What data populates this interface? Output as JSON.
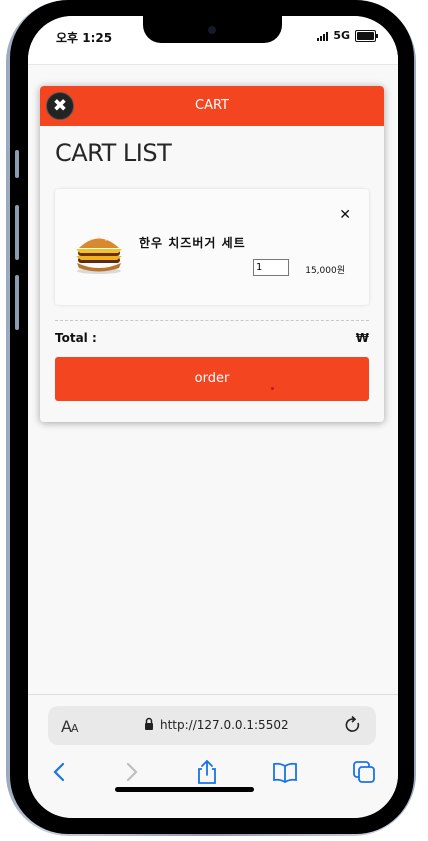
{
  "status_bar": {
    "time": "오후 1:25",
    "network": "5G"
  },
  "modal": {
    "header_title": "CART",
    "close_icon": "x-circle-icon",
    "cart_title": "CART LIST",
    "items": [
      {
        "name": "한우 치즈버거 세트",
        "quantity": "1",
        "price": "15,000원",
        "image": "burger-image",
        "remove_icon": "close-icon"
      }
    ],
    "total_label": "Total :",
    "total_currency": "₩",
    "order_label": "order"
  },
  "browser": {
    "aa_label": "AA",
    "url": "http://127.0.0.1:5502",
    "icons": [
      "back-icon",
      "forward-icon",
      "share-icon",
      "bookmarks-icon",
      "tabs-icon"
    ]
  },
  "colors": {
    "accent": "#f3451f",
    "ios_blue": "#1a73e8"
  }
}
